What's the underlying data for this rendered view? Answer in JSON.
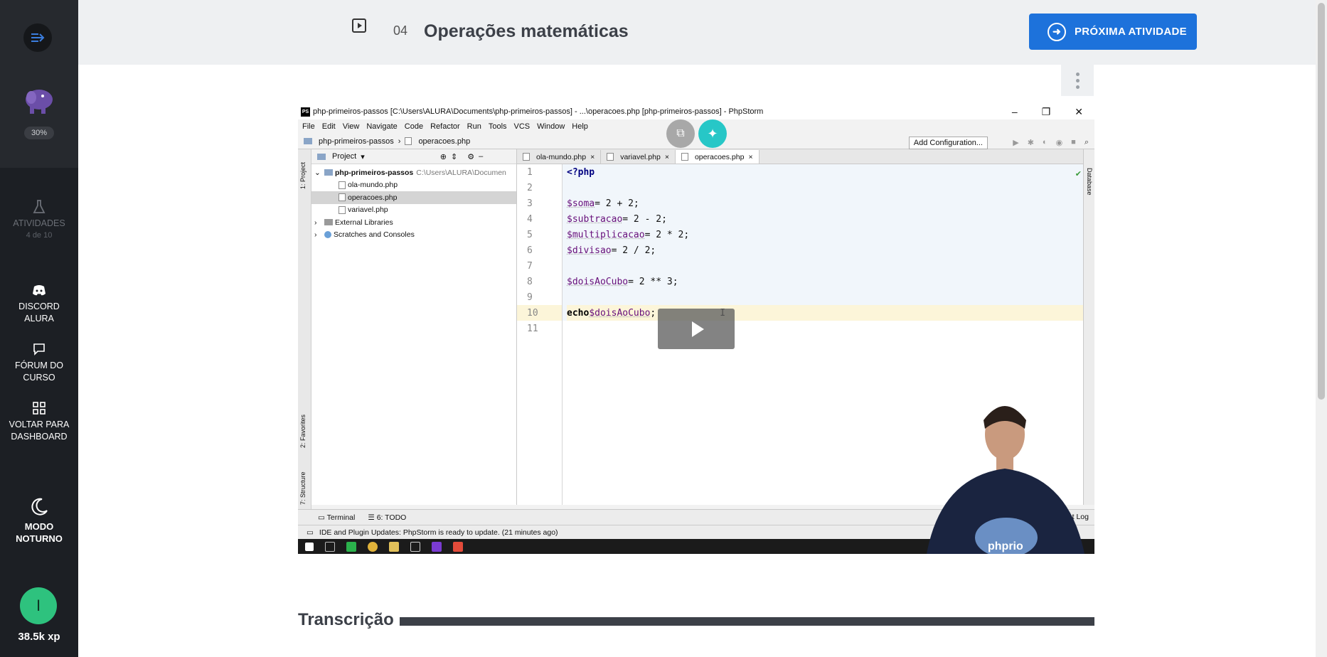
{
  "sidebar": {
    "menu_icon": "menu-arrow-icon",
    "course_icon": "php-elephant-icon",
    "progress": "30%",
    "activities_label": "ATIVIDADES",
    "activities_sub": "4 de 10",
    "discord_label": "DISCORD ALURA",
    "forum_label": "FÓRUM DO CURSO",
    "dashboard_label": "VOLTAR PARA DASHBOARD",
    "night_mode_label": "MODO NOTURNO",
    "avatar_initial": "I",
    "xp": "38.5k xp"
  },
  "header": {
    "lesson_number": "04",
    "lesson_title": "Operações matemáticas",
    "next_button_label": "PRÓXIMA ATIVIDADE"
  },
  "video": {
    "window_title": "php-primeiros-passos [C:\\Users\\ALURA\\Documents\\php-primeiros-passos] - ...\\operacoes.php [php-primeiros-passos] - PhpStorm",
    "menu": [
      "File",
      "Edit",
      "View",
      "Navigate",
      "Code",
      "Refactor",
      "Run",
      "Tools",
      "VCS",
      "Window",
      "Help"
    ],
    "breadcrumb": [
      "php-primeiros-passos",
      "operacoes.php"
    ],
    "add_configuration": "Add Configuration...",
    "project_label": "Project",
    "tree": {
      "root": "php-primeiros-passos",
      "root_path": "C:\\Users\\ALURA\\Documen",
      "files": [
        "ola-mundo.php",
        "operacoes.php",
        "variavel.php"
      ],
      "external": "External Libraries",
      "scratches": "Scratches and Consoles"
    },
    "tabs": [
      "ola-mundo.php",
      "variavel.php",
      "operacoes.php"
    ],
    "line_numbers": [
      "1",
      "2",
      "3",
      "4",
      "5",
      "6",
      "7",
      "8",
      "9",
      "10",
      "11"
    ],
    "code": {
      "l1": "<?php",
      "l3_var": "$soma",
      "l3_rest": " = 2 + 2;",
      "l4_var": "$subtracao",
      "l4_rest": " = 2 - 2;",
      "l5_var": "$multiplicacao",
      "l5_rest": " = 2 * 2;",
      "l6_var": "$divisao",
      "l6_rest": " = 2 / 2;",
      "l8_var": "$doisAoCubo",
      "l8_rest": " = 2 ** 3;",
      "l10_kw": "echo",
      "l10_var": " $doisAoCubo",
      "l10_rest": ";"
    },
    "bottom_tabs": [
      "Terminal",
      "6: TODO"
    ],
    "event_log": "Event Log",
    "status": "IDE and Plugin Updates: PhpStorm is ready to update. (21 minutes ago)",
    "strip_labels": [
      "1: Project",
      "2: Favorites",
      "7: Structure"
    ],
    "right_strip_label": "Database"
  },
  "transcription_title": "Transcrição"
}
